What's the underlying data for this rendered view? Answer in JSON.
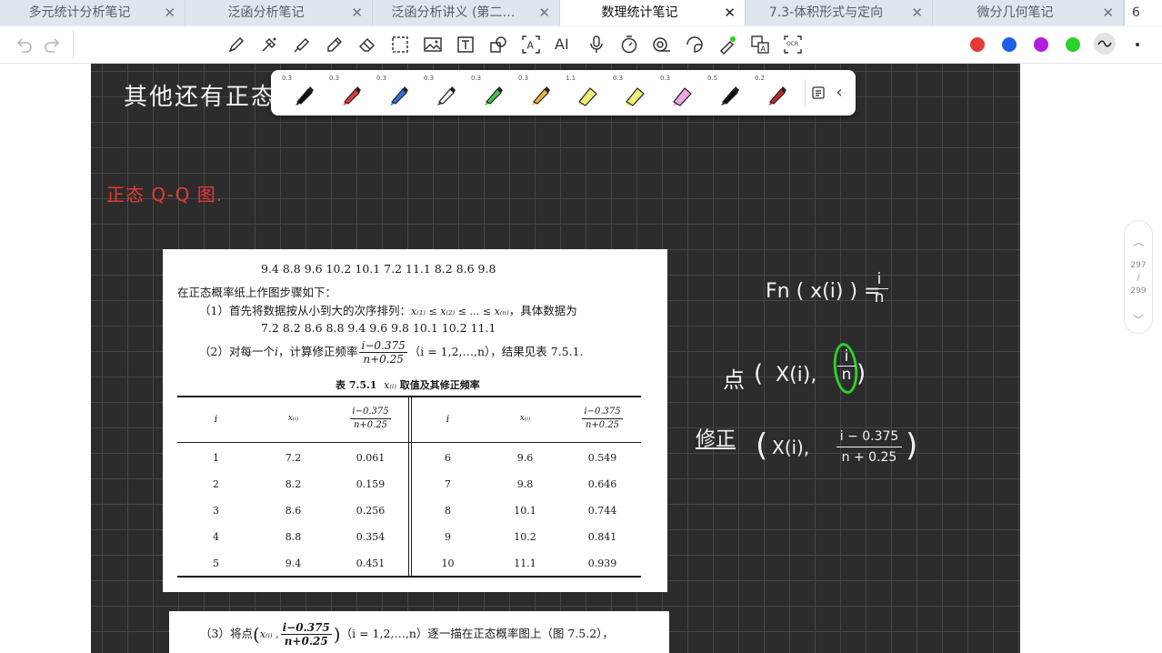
{
  "tabs": [
    {
      "label": "多元统计分析笔记",
      "active": false
    },
    {
      "label": "泛函分析笔记",
      "active": false
    },
    {
      "label": "泛函分析讲义 (第二…",
      "active": false
    },
    {
      "label": "数理统计笔记",
      "active": true
    },
    {
      "label": "7.3-体积形式与定向",
      "active": false
    },
    {
      "label": "微分几何笔记",
      "active": false
    }
  ],
  "tab_close_glyph": "✕",
  "tab_count": "6",
  "toolbar": {
    "icons": [
      "pen-icon",
      "fountain-pen-icon",
      "marker-icon",
      "highlighter-icon",
      "eraser-icon",
      "lasso-select-icon",
      "image-icon",
      "text-box-icon",
      "shapes-icon",
      "text-recognition-icon",
      "ai-icon",
      "microphone-icon",
      "timer-icon",
      "tape-icon",
      "sticker-icon",
      "laser-pointer-icon",
      "translate-icon",
      "ocr-icon"
    ],
    "ai_label": "AI",
    "ocr_label": "OCR",
    "colors": [
      "#e53935",
      "#1e5fe8",
      "#b21ee0",
      "#2bd22b"
    ],
    "more_glyph": "•"
  },
  "pen_panel": {
    "pens": [
      {
        "width": "0.3",
        "color": "#111111"
      },
      {
        "width": "0.3",
        "color": "#e53935"
      },
      {
        "width": "0.3",
        "color": "#2f6fe4"
      },
      {
        "width": "0.3",
        "color": "#f2f2f2"
      },
      {
        "width": "0.3",
        "color": "#3ec93e"
      },
      {
        "width": "0.3",
        "color": "#f0b43c"
      },
      {
        "width": "1.1",
        "color": "#f5ee7a"
      },
      {
        "width": "0.3",
        "color": "#eef07a"
      },
      {
        "width": "0.3",
        "color": "#f0a6e6"
      },
      {
        "width": "0.5",
        "color": "#111111"
      },
      {
        "width": "0.2",
        "color": "#c62828"
      }
    ],
    "collapse_glyph": "‹"
  },
  "notes": {
    "heading_top": "其他还有正态",
    "heading_red": "正态 Q-Q 图.",
    "fn_formula": {
      "lhs": "Fn ( x(i) ) =",
      "num": "i",
      "den": "n"
    },
    "point": {
      "label": "点",
      "open": "(",
      "x": "X(i),",
      "num": "i",
      "den": "n",
      "close": ")"
    },
    "corrected": {
      "label": "修正",
      "open": "(",
      "x": "X(i),",
      "num": "i − 0.375",
      "den": "n + 0.25",
      "close": ")"
    }
  },
  "textbook": {
    "data_row": "9.4    8.8    9.6    10.2    10.1    7.2    11.1    8.2    8.6    9.8",
    "intro": "在正态概率纸上作图步骤如下：",
    "step1_a": "（1）首先将数据按从小到大的次序排列：",
    "step1_order": "x₍₁₎ ≤ x₍₂₎ ≤ … ≤ x₍ₙ₎",
    "step1_b": "，具体数据为",
    "sorted_row": "7.2    8.2    8.6    8.8    9.4    9.6    9.8    10.1    10.2    11.1",
    "step2_a": "（2）对每一个",
    "step2_i": "i",
    "step2_b": "，计算修正频率",
    "step2_num": "i−0.375",
    "step2_den": "n+0.25",
    "step2_c": "（i = 1,2,…,n），结果见表 7.5.1.",
    "table_caption_a": "表 7.5.1",
    "table_caption_x": "x₍ᵢ₎",
    "table_caption_b": "取值及其修正频率",
    "table_headers": [
      "i",
      "x₍ᵢ₎",
      "i−0.375",
      "n+0.25"
    ],
    "table_rows": [
      {
        "i1": "1",
        "x1": "7.2",
        "p1": "0.061",
        "i2": "6",
        "x2": "9.6",
        "p2": "0.549"
      },
      {
        "i1": "2",
        "x1": "8.2",
        "p1": "0.159",
        "i2": "7",
        "x2": "9.8",
        "p2": "0.646"
      },
      {
        "i1": "3",
        "x1": "8.6",
        "p1": "0.256",
        "i2": "8",
        "x2": "10.1",
        "p2": "0.744"
      },
      {
        "i1": "4",
        "x1": "8.8",
        "p1": "0.354",
        "i2": "9",
        "x2": "10.2",
        "p2": "0.841"
      },
      {
        "i1": "5",
        "x1": "9.4",
        "p1": "0.451",
        "i2": "10",
        "x2": "11.1",
        "p2": "0.939"
      }
    ],
    "step3_a": "（3）将点",
    "step3_x": "x₍ᵢ₎ ,",
    "step3_num": "i−0.375",
    "step3_den": "n+0.25",
    "step3_b": "（i = 1,2,…,n）逐一描在正态概率图上（图 7.5.2），"
  },
  "page_nav": {
    "up": "︿",
    "current": "297",
    "sep": "/",
    "total": "299",
    "down": "﹀"
  }
}
